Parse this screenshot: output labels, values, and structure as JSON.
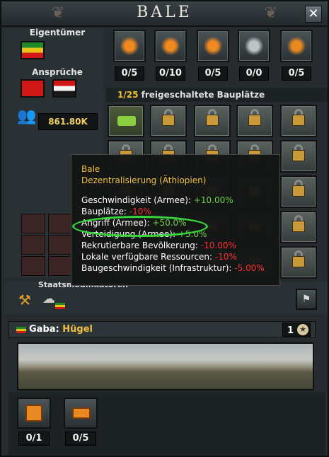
{
  "title": "BALE",
  "owner_label": "Eigentümer",
  "claims_label": "Ansprüche",
  "buildings": [
    {
      "icon": "road-icon",
      "count": "0/5"
    },
    {
      "icon": "airbase-icon",
      "count": "0/10"
    },
    {
      "icon": "anti-air-icon",
      "count": "0/5"
    },
    {
      "icon": "radar-icon",
      "count": "0/0"
    },
    {
      "icon": "railway-icon",
      "count": "0/5"
    }
  ],
  "slots": {
    "prefix": "1/25",
    "text": " freigeschaltete Bauplätze"
  },
  "manpower": "861.80K",
  "tooltip": {
    "title": "Bale",
    "subtitle": "Dezentralisierung (Äthiopien)",
    "rows": [
      {
        "label": "Geschwindigkeit (Armee): ",
        "value": "+10.00%",
        "cls": "g"
      },
      {
        "label": "Bauplätze: ",
        "value": "-10%",
        "cls": "r"
      },
      {
        "label": "Angriff (Armee): ",
        "value": "+50.0%",
        "cls": "g"
      },
      {
        "label": "Verteidigung (Armee): ",
        "value": "+5.0%",
        "cls": "g"
      },
      {
        "label": "Rekrutierbare Bevölkerung: ",
        "value": "-10.00%",
        "cls": "r"
      },
      {
        "label": "Lokale verfügbare Ressourcen: ",
        "value": "-10%",
        "cls": "r"
      },
      {
        "label": "Baugeschwindigkeit (Infrastruktur): ",
        "value": "-5.00%",
        "cls": "r"
      }
    ]
  },
  "state_modifiers_label": "Staatsmodifikatoren",
  "region": {
    "name": "Gaba",
    "terrain": "Hügel",
    "victory_points": "1"
  },
  "bottom_buildings": [
    {
      "icon": "supply-crates-icon",
      "count": "0/1"
    },
    {
      "icon": "bunker-icon",
      "count": "0/5"
    }
  ],
  "colors": {
    "accent_yellow": "#f0c040",
    "positive": "#6cd24c",
    "negative": "#ff3030",
    "highlight": "#36d63a"
  }
}
